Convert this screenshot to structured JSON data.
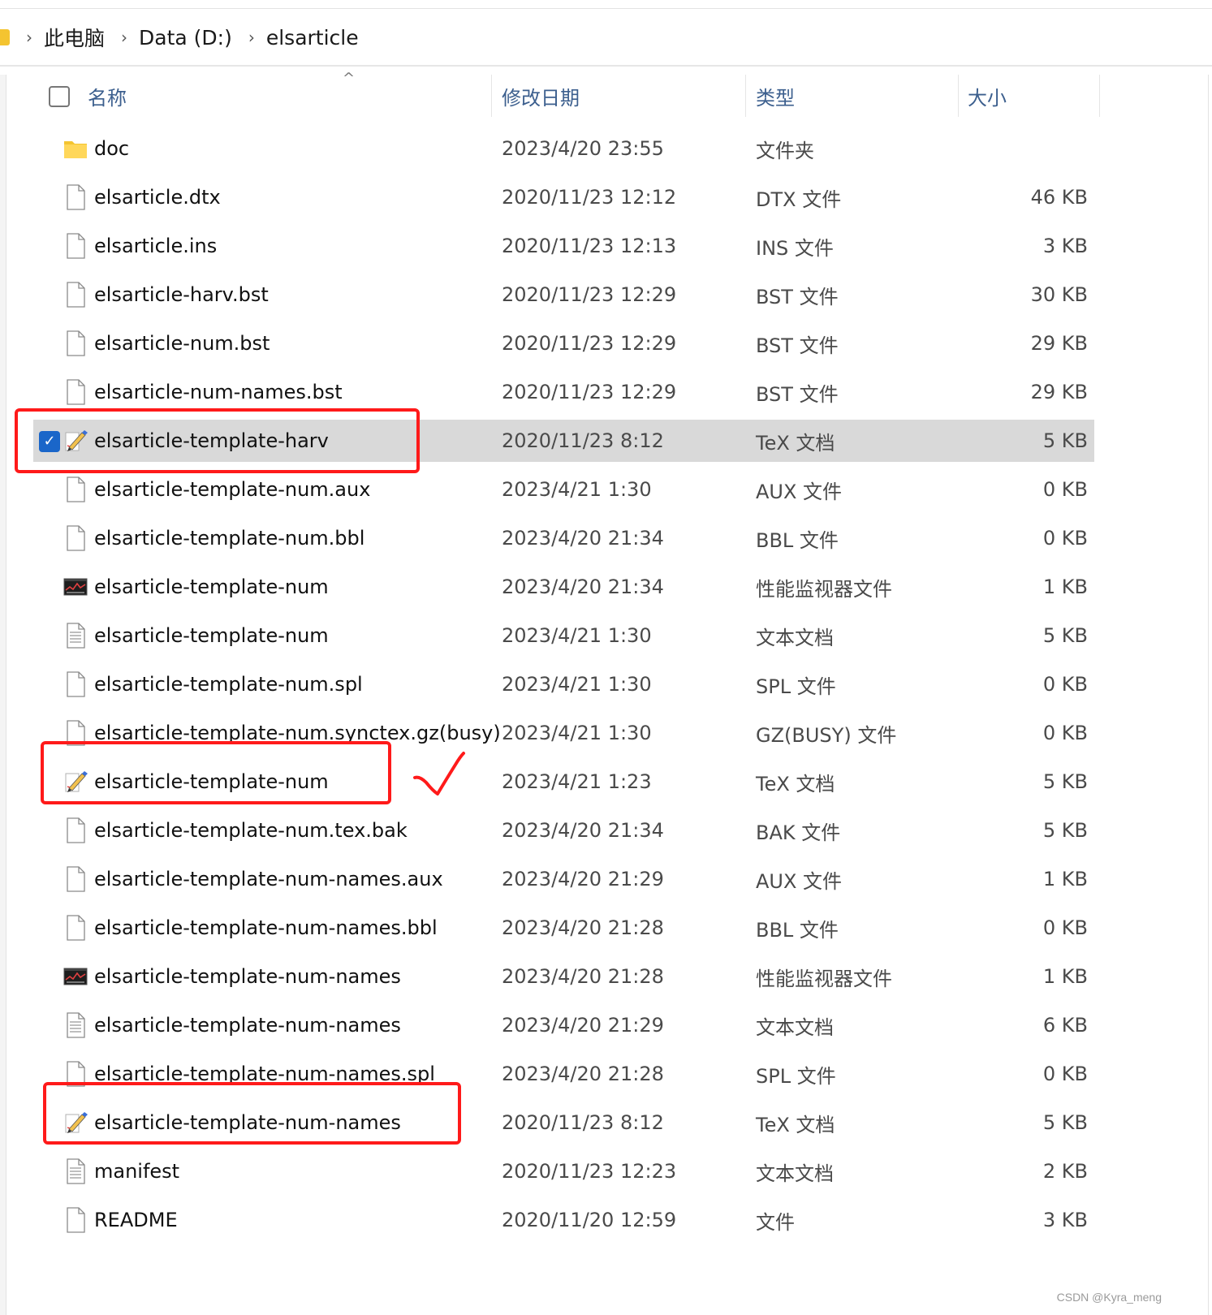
{
  "breadcrumb": {
    "items": [
      "此电脑",
      "Data (D:)",
      "elsarticle"
    ],
    "separator": "›"
  },
  "columns": {
    "name": "名称",
    "date": "修改日期",
    "type": "类型",
    "size": "大小",
    "sort_indicator": "^"
  },
  "files": [
    {
      "name": "doc",
      "date": "2023/4/20 23:55",
      "type": "文件夹",
      "size": "",
      "icon": "folder-icon"
    },
    {
      "name": "elsarticle.dtx",
      "date": "2020/11/23 12:12",
      "type": "DTX 文件",
      "size": "46 KB",
      "icon": "file-icon"
    },
    {
      "name": "elsarticle.ins",
      "date": "2020/11/23 12:13",
      "type": "INS 文件",
      "size": "3 KB",
      "icon": "file-icon"
    },
    {
      "name": "elsarticle-harv.bst",
      "date": "2020/11/23 12:29",
      "type": "BST 文件",
      "size": "30 KB",
      "icon": "file-icon"
    },
    {
      "name": "elsarticle-num.bst",
      "date": "2020/11/23 12:29",
      "type": "BST 文件",
      "size": "29 KB",
      "icon": "file-icon"
    },
    {
      "name": "elsarticle-num-names.bst",
      "date": "2020/11/23 12:29",
      "type": "BST 文件",
      "size": "29 KB",
      "icon": "file-icon"
    },
    {
      "name": "elsarticle-template-harv",
      "date": "2020/11/23 8:12",
      "type": "TeX 文档",
      "size": "5 KB",
      "icon": "tex-document-icon",
      "selected": true
    },
    {
      "name": "elsarticle-template-num.aux",
      "date": "2023/4/21 1:30",
      "type": "AUX 文件",
      "size": "0 KB",
      "icon": "file-icon"
    },
    {
      "name": "elsarticle-template-num.bbl",
      "date": "2023/4/20 21:34",
      "type": "BBL 文件",
      "size": "0 KB",
      "icon": "file-icon"
    },
    {
      "name": "elsarticle-template-num",
      "date": "2023/4/20 21:34",
      "type": "性能监视器文件",
      "size": "1 KB",
      "icon": "performance-monitor-icon"
    },
    {
      "name": "elsarticle-template-num",
      "date": "2023/4/21 1:30",
      "type": "文本文档",
      "size": "5 KB",
      "icon": "text-document-icon"
    },
    {
      "name": "elsarticle-template-num.spl",
      "date": "2023/4/21 1:30",
      "type": "SPL 文件",
      "size": "0 KB",
      "icon": "file-icon"
    },
    {
      "name": "elsarticle-template-num.synctex.gz(busy)",
      "date": "2023/4/21 1:30",
      "type": "GZ(BUSY) 文件",
      "size": "0 KB",
      "icon": "file-icon"
    },
    {
      "name": "elsarticle-template-num",
      "date": "2023/4/21 1:23",
      "type": "TeX 文档",
      "size": "5 KB",
      "icon": "tex-document-icon"
    },
    {
      "name": "elsarticle-template-num.tex.bak",
      "date": "2023/4/20 21:34",
      "type": "BAK 文件",
      "size": "5 KB",
      "icon": "file-icon"
    },
    {
      "name": "elsarticle-template-num-names.aux",
      "date": "2023/4/20 21:29",
      "type": "AUX 文件",
      "size": "1 KB",
      "icon": "file-icon"
    },
    {
      "name": "elsarticle-template-num-names.bbl",
      "date": "2023/4/20 21:28",
      "type": "BBL 文件",
      "size": "0 KB",
      "icon": "file-icon"
    },
    {
      "name": "elsarticle-template-num-names",
      "date": "2023/4/20 21:28",
      "type": "性能监视器文件",
      "size": "1 KB",
      "icon": "performance-monitor-icon"
    },
    {
      "name": "elsarticle-template-num-names",
      "date": "2023/4/20 21:29",
      "type": "文本文档",
      "size": "6 KB",
      "icon": "text-document-icon"
    },
    {
      "name": "elsarticle-template-num-names.spl",
      "date": "2023/4/20 21:28",
      "type": "SPL 文件",
      "size": "0 KB",
      "icon": "file-icon"
    },
    {
      "name": "elsarticle-template-num-names",
      "date": "2020/11/23 8:12",
      "type": "TeX 文档",
      "size": "5 KB",
      "icon": "tex-document-icon"
    },
    {
      "name": "manifest",
      "date": "2020/11/23 12:23",
      "type": "文本文档",
      "size": "2 KB",
      "icon": "text-document-icon"
    },
    {
      "name": "README",
      "date": "2020/11/20 12:59",
      "type": "文件",
      "size": "3 KB",
      "icon": "file-icon"
    }
  ],
  "annotations": {
    "highlight_color": "#ff1a1a",
    "highlighted_rows": [
      6,
      13,
      20
    ],
    "checkmark_row": 13
  },
  "colors": {
    "selection": "#d9d9d9",
    "checkbox_accent": "#1a66c9",
    "header_text": "#3c5f8e",
    "folder": "#f4c430"
  },
  "watermark": "CSDN @Kyra_meng"
}
